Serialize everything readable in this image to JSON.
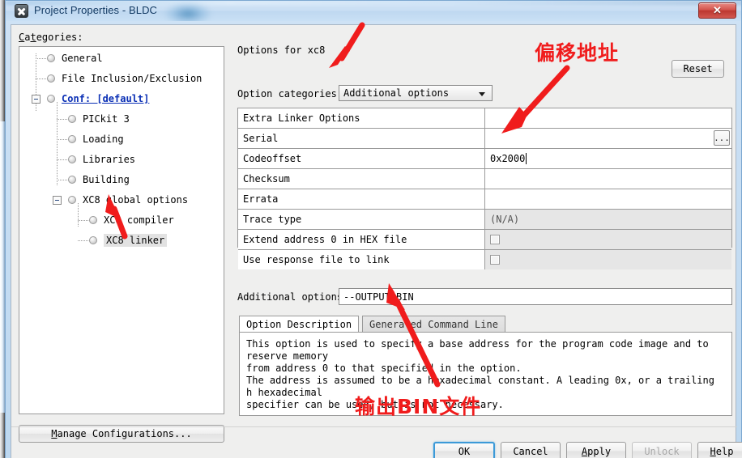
{
  "window": {
    "title": "Project Properties - BLDC",
    "app_icon": "x-mark-icon",
    "close_label": "✕"
  },
  "left": {
    "categories_label": "Categories:",
    "tree": [
      {
        "label": "General",
        "depth": 0,
        "bold": false
      },
      {
        "label": "File Inclusion/Exclusion",
        "depth": 0,
        "bold": false
      },
      {
        "label": "Conf: [default]",
        "depth": 0,
        "bold": true
      },
      {
        "label": "PICkit 3",
        "depth": 1,
        "bold": false
      },
      {
        "label": "Loading",
        "depth": 1,
        "bold": false
      },
      {
        "label": "Libraries",
        "depth": 1,
        "bold": false
      },
      {
        "label": "Building",
        "depth": 1,
        "bold": false
      },
      {
        "label": "XC8 global options",
        "depth": 1,
        "bold": false
      },
      {
        "label": "XC8 compiler",
        "depth": 2,
        "bold": false
      },
      {
        "label": "XC8 linker",
        "depth": 2,
        "bold": false,
        "selected": true
      }
    ],
    "manage_configurations_button": "Manage Configurations..."
  },
  "right": {
    "options_for_label": "Options for xc8",
    "option_categories_label": "Option categories:",
    "option_categories_value": "Additional options",
    "reset_button": "Reset",
    "table": {
      "rows": [
        {
          "name": "Extra Linker Options",
          "value": "",
          "kind": "text"
        },
        {
          "name": "Serial",
          "value": "",
          "kind": "text-ellipsis",
          "ellipsis": "..."
        },
        {
          "name": "Codeoffset",
          "value": "0x2000",
          "kind": "text",
          "focused": true
        },
        {
          "name": "Checksum",
          "value": "",
          "kind": "text"
        },
        {
          "name": "Errata",
          "value": "",
          "kind": "text"
        },
        {
          "name": "Trace type",
          "value": "(N/A)",
          "kind": "readonly"
        },
        {
          "name": "Extend address 0 in HEX file",
          "value": "",
          "kind": "checkbox",
          "checked": false
        },
        {
          "name": "Use response file to link",
          "value": "",
          "kind": "checkbox",
          "checked": false
        }
      ]
    },
    "additional_options_label": "Additional options:",
    "additional_options_value": "--OUTPUT=BIN",
    "tabs": [
      {
        "label": "Option Description",
        "active": true
      },
      {
        "label": "Generated Command Line",
        "active": false
      }
    ],
    "description": "This option is used to specify a base address for the program code image and to reserve memory\nfrom address 0 to that specified in the option.\nThe address is assumed to be a hexadecimal constant. A leading 0x, or a trailing h hexadecimal\nspecifier can be used, but is not necessary."
  },
  "footer": {
    "buttons": [
      {
        "label": "OK",
        "style": "default"
      },
      {
        "label": "Cancel",
        "style": "normal"
      },
      {
        "label": "Apply",
        "style": "normal"
      },
      {
        "label": "Unlock",
        "style": "disabled"
      },
      {
        "label": "Help",
        "style": "normal"
      }
    ]
  },
  "annotations": {
    "top_note": "偏移地址",
    "bottom_note": "输出BIN文件",
    "color": "#f01c1c"
  }
}
